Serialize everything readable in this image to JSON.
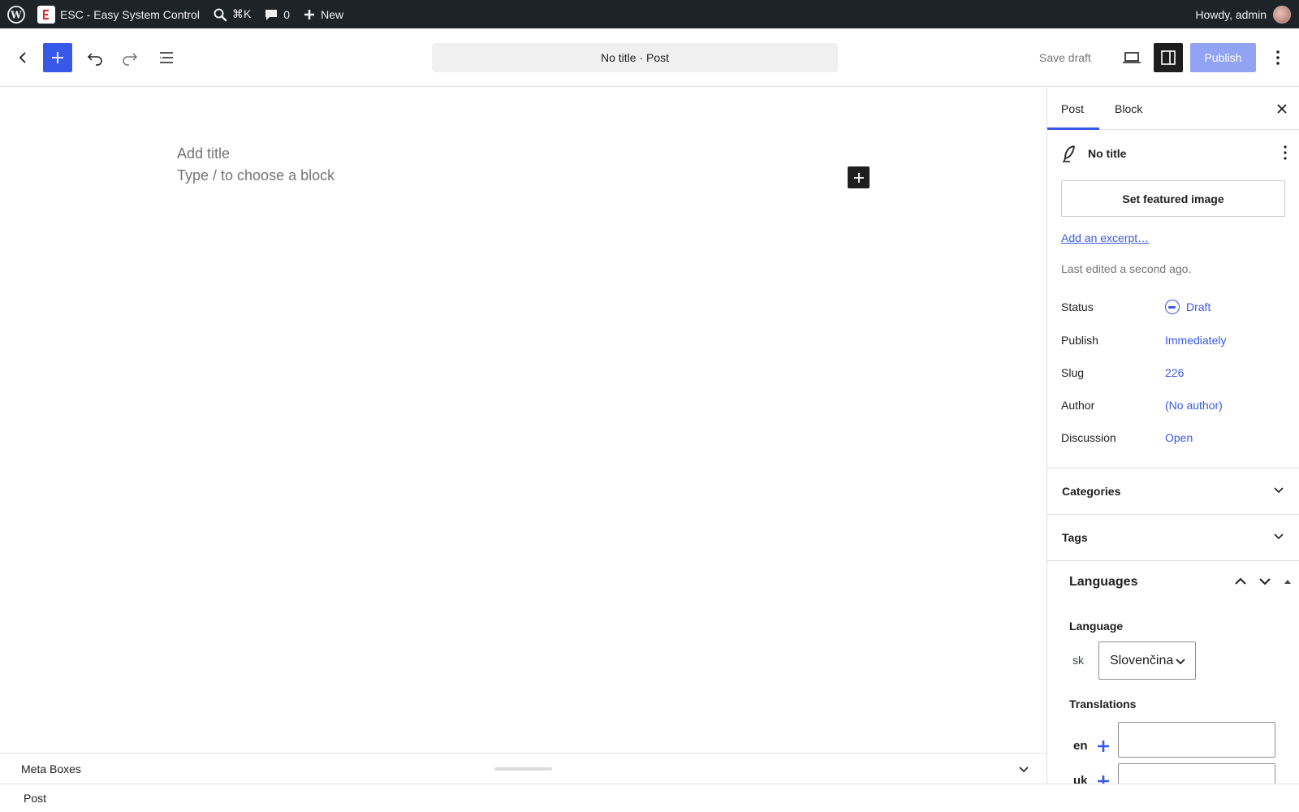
{
  "adminbar": {
    "site_name": "ESC - Easy System Control",
    "search_shortcut": "⌘K",
    "comments_count": "0",
    "new_label": "New",
    "howdy": "Howdy, admin"
  },
  "header": {
    "doc_title": "No title · Post",
    "save_draft": "Save draft",
    "publish": "Publish"
  },
  "canvas": {
    "title_placeholder": "Add title",
    "paragraph_placeholder": "Type / to choose a block"
  },
  "metabox": {
    "title": "Meta Boxes"
  },
  "footer": {
    "breadcrumb": "Post"
  },
  "sidebar": {
    "tabs": [
      {
        "label": "Post"
      },
      {
        "label": "Block"
      }
    ],
    "post_title": "No title",
    "featured_image": "Set featured image",
    "excerpt": "Add an excerpt…",
    "last_edited": "Last edited a second ago.",
    "rows": [
      {
        "label": "Status",
        "value": "Draft"
      },
      {
        "label": "Publish",
        "value": "Immediately"
      },
      {
        "label": "Slug",
        "value": "226"
      },
      {
        "label": "Author",
        "value": "(No author)"
      },
      {
        "label": "Discussion",
        "value": "Open"
      }
    ],
    "panels": [
      {
        "title": "Categories"
      },
      {
        "title": "Tags"
      }
    ],
    "languages": {
      "title": "Languages",
      "language_label": "Language",
      "current_code": "sk",
      "current_language": "Slovenčina",
      "translations_label": "Translations",
      "translations": [
        {
          "code": "en"
        },
        {
          "code": "uk"
        }
      ]
    }
  },
  "colors": {
    "accent": "#3858e9",
    "adminbar": "#1d2327",
    "text": "#1e1e1e",
    "muted": "#757575"
  }
}
